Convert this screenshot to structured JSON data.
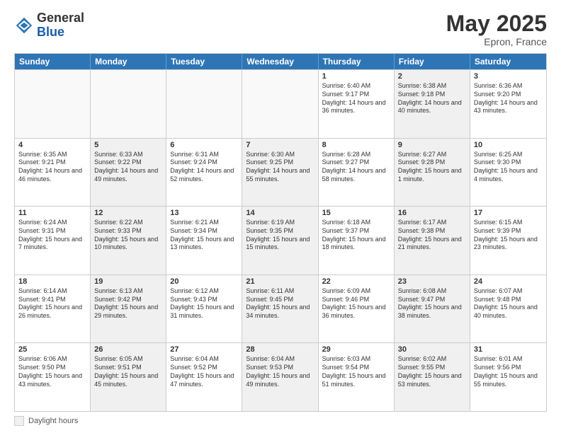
{
  "app": {
    "logo_general": "General",
    "logo_blue": "Blue"
  },
  "header": {
    "month": "May 2025",
    "location": "Epron, France"
  },
  "weekdays": [
    "Sunday",
    "Monday",
    "Tuesday",
    "Wednesday",
    "Thursday",
    "Friday",
    "Saturday"
  ],
  "legend": {
    "label": "Daylight hours"
  },
  "weeks": [
    [
      {
        "day": "",
        "sunrise": "",
        "sunset": "",
        "daylight": "",
        "shaded": false,
        "empty": true
      },
      {
        "day": "",
        "sunrise": "",
        "sunset": "",
        "daylight": "",
        "shaded": false,
        "empty": true
      },
      {
        "day": "",
        "sunrise": "",
        "sunset": "",
        "daylight": "",
        "shaded": false,
        "empty": true
      },
      {
        "day": "",
        "sunrise": "",
        "sunset": "",
        "daylight": "",
        "shaded": false,
        "empty": true
      },
      {
        "day": "1",
        "sunrise": "Sunrise: 6:40 AM",
        "sunset": "Sunset: 9:17 PM",
        "daylight": "Daylight: 14 hours and 36 minutes.",
        "shaded": false,
        "empty": false
      },
      {
        "day": "2",
        "sunrise": "Sunrise: 6:38 AM",
        "sunset": "Sunset: 9:18 PM",
        "daylight": "Daylight: 14 hours and 40 minutes.",
        "shaded": true,
        "empty": false
      },
      {
        "day": "3",
        "sunrise": "Sunrise: 6:36 AM",
        "sunset": "Sunset: 9:20 PM",
        "daylight": "Daylight: 14 hours and 43 minutes.",
        "shaded": false,
        "empty": false
      }
    ],
    [
      {
        "day": "4",
        "sunrise": "Sunrise: 6:35 AM",
        "sunset": "Sunset: 9:21 PM",
        "daylight": "Daylight: 14 hours and 46 minutes.",
        "shaded": false,
        "empty": false
      },
      {
        "day": "5",
        "sunrise": "Sunrise: 6:33 AM",
        "sunset": "Sunset: 9:22 PM",
        "daylight": "Daylight: 14 hours and 49 minutes.",
        "shaded": true,
        "empty": false
      },
      {
        "day": "6",
        "sunrise": "Sunrise: 6:31 AM",
        "sunset": "Sunset: 9:24 PM",
        "daylight": "Daylight: 14 hours and 52 minutes.",
        "shaded": false,
        "empty": false
      },
      {
        "day": "7",
        "sunrise": "Sunrise: 6:30 AM",
        "sunset": "Sunset: 9:25 PM",
        "daylight": "Daylight: 14 hours and 55 minutes.",
        "shaded": true,
        "empty": false
      },
      {
        "day": "8",
        "sunrise": "Sunrise: 6:28 AM",
        "sunset": "Sunset: 9:27 PM",
        "daylight": "Daylight: 14 hours and 58 minutes.",
        "shaded": false,
        "empty": false
      },
      {
        "day": "9",
        "sunrise": "Sunrise: 6:27 AM",
        "sunset": "Sunset: 9:28 PM",
        "daylight": "Daylight: 15 hours and 1 minute.",
        "shaded": true,
        "empty": false
      },
      {
        "day": "10",
        "sunrise": "Sunrise: 6:25 AM",
        "sunset": "Sunset: 9:30 PM",
        "daylight": "Daylight: 15 hours and 4 minutes.",
        "shaded": false,
        "empty": false
      }
    ],
    [
      {
        "day": "11",
        "sunrise": "Sunrise: 6:24 AM",
        "sunset": "Sunset: 9:31 PM",
        "daylight": "Daylight: 15 hours and 7 minutes.",
        "shaded": false,
        "empty": false
      },
      {
        "day": "12",
        "sunrise": "Sunrise: 6:22 AM",
        "sunset": "Sunset: 9:33 PM",
        "daylight": "Daylight: 15 hours and 10 minutes.",
        "shaded": true,
        "empty": false
      },
      {
        "day": "13",
        "sunrise": "Sunrise: 6:21 AM",
        "sunset": "Sunset: 9:34 PM",
        "daylight": "Daylight: 15 hours and 13 minutes.",
        "shaded": false,
        "empty": false
      },
      {
        "day": "14",
        "sunrise": "Sunrise: 6:19 AM",
        "sunset": "Sunset: 9:35 PM",
        "daylight": "Daylight: 15 hours and 15 minutes.",
        "shaded": true,
        "empty": false
      },
      {
        "day": "15",
        "sunrise": "Sunrise: 6:18 AM",
        "sunset": "Sunset: 9:37 PM",
        "daylight": "Daylight: 15 hours and 18 minutes.",
        "shaded": false,
        "empty": false
      },
      {
        "day": "16",
        "sunrise": "Sunrise: 6:17 AM",
        "sunset": "Sunset: 9:38 PM",
        "daylight": "Daylight: 15 hours and 21 minutes.",
        "shaded": true,
        "empty": false
      },
      {
        "day": "17",
        "sunrise": "Sunrise: 6:15 AM",
        "sunset": "Sunset: 9:39 PM",
        "daylight": "Daylight: 15 hours and 23 minutes.",
        "shaded": false,
        "empty": false
      }
    ],
    [
      {
        "day": "18",
        "sunrise": "Sunrise: 6:14 AM",
        "sunset": "Sunset: 9:41 PM",
        "daylight": "Daylight: 15 hours and 26 minutes.",
        "shaded": false,
        "empty": false
      },
      {
        "day": "19",
        "sunrise": "Sunrise: 6:13 AM",
        "sunset": "Sunset: 9:42 PM",
        "daylight": "Daylight: 15 hours and 29 minutes.",
        "shaded": true,
        "empty": false
      },
      {
        "day": "20",
        "sunrise": "Sunrise: 6:12 AM",
        "sunset": "Sunset: 9:43 PM",
        "daylight": "Daylight: 15 hours and 31 minutes.",
        "shaded": false,
        "empty": false
      },
      {
        "day": "21",
        "sunrise": "Sunrise: 6:11 AM",
        "sunset": "Sunset: 9:45 PM",
        "daylight": "Daylight: 15 hours and 34 minutes.",
        "shaded": true,
        "empty": false
      },
      {
        "day": "22",
        "sunrise": "Sunrise: 6:09 AM",
        "sunset": "Sunset: 9:46 PM",
        "daylight": "Daylight: 15 hours and 36 minutes.",
        "shaded": false,
        "empty": false
      },
      {
        "day": "23",
        "sunrise": "Sunrise: 6:08 AM",
        "sunset": "Sunset: 9:47 PM",
        "daylight": "Daylight: 15 hours and 38 minutes.",
        "shaded": true,
        "empty": false
      },
      {
        "day": "24",
        "sunrise": "Sunrise: 6:07 AM",
        "sunset": "Sunset: 9:48 PM",
        "daylight": "Daylight: 15 hours and 40 minutes.",
        "shaded": false,
        "empty": false
      }
    ],
    [
      {
        "day": "25",
        "sunrise": "Sunrise: 6:06 AM",
        "sunset": "Sunset: 9:50 PM",
        "daylight": "Daylight: 15 hours and 43 minutes.",
        "shaded": false,
        "empty": false
      },
      {
        "day": "26",
        "sunrise": "Sunrise: 6:05 AM",
        "sunset": "Sunset: 9:51 PM",
        "daylight": "Daylight: 15 hours and 45 minutes.",
        "shaded": true,
        "empty": false
      },
      {
        "day": "27",
        "sunrise": "Sunrise: 6:04 AM",
        "sunset": "Sunset: 9:52 PM",
        "daylight": "Daylight: 15 hours and 47 minutes.",
        "shaded": false,
        "empty": false
      },
      {
        "day": "28",
        "sunrise": "Sunrise: 6:04 AM",
        "sunset": "Sunset: 9:53 PM",
        "daylight": "Daylight: 15 hours and 49 minutes.",
        "shaded": true,
        "empty": false
      },
      {
        "day": "29",
        "sunrise": "Sunrise: 6:03 AM",
        "sunset": "Sunset: 9:54 PM",
        "daylight": "Daylight: 15 hours and 51 minutes.",
        "shaded": false,
        "empty": false
      },
      {
        "day": "30",
        "sunrise": "Sunrise: 6:02 AM",
        "sunset": "Sunset: 9:55 PM",
        "daylight": "Daylight: 15 hours and 53 minutes.",
        "shaded": true,
        "empty": false
      },
      {
        "day": "31",
        "sunrise": "Sunrise: 6:01 AM",
        "sunset": "Sunset: 9:56 PM",
        "daylight": "Daylight: 15 hours and 55 minutes.",
        "shaded": false,
        "empty": false
      }
    ]
  ]
}
